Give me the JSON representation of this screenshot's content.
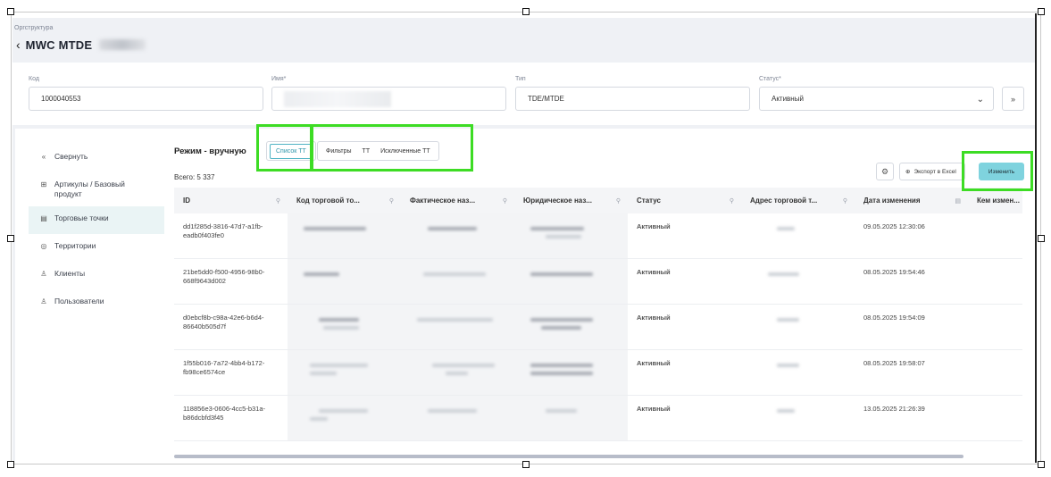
{
  "breadcrumb": "Оргструктура",
  "title": "MWC MTDE",
  "form": {
    "code_label": "Код",
    "code_value": "1000040553",
    "name_label": "Имя*",
    "type_label": "Тип",
    "type_value": "TDE/MTDE",
    "status_label": "Статус*",
    "status_value": "Активный"
  },
  "sidebar": {
    "items": [
      {
        "label": "Свернуть",
        "icon": "collapse-icon"
      },
      {
        "label": "Артикулы / Базовый продукт",
        "icon": "box-icon"
      },
      {
        "label": "Торговые точки",
        "icon": "store-icon"
      },
      {
        "label": "Территории",
        "icon": "map-pin-icon"
      },
      {
        "label": "Клиенты",
        "icon": "user-icon"
      },
      {
        "label": "Пользователи",
        "icon": "user-icon"
      }
    ]
  },
  "toolbar": {
    "mode": "Режим - вручную",
    "tabs_a": [
      "Список ТТ"
    ],
    "tabs_b": [
      "Фильтры",
      "ТТ",
      "Исключенные ТТ"
    ],
    "total": "Всего: 5 337",
    "export": "Экспорт в Excel",
    "edit": "Изменить"
  },
  "table": {
    "columns": [
      "ID",
      "Код торговой то...",
      "Фактическое наз...",
      "Юридическое наз...",
      "Статус",
      "Адрес торговой т...",
      "Дата изменения",
      "Кем измен..."
    ],
    "rows": [
      {
        "id": "dd1f285d-3816-47d7-a1fb-eadb0f403fe0",
        "status": "Активный",
        "date": "09.05.2025 12:30:06"
      },
      {
        "id": "21be5dd0-f500-4956-98b0-668f9643d002",
        "status": "Активный",
        "date": "08.05.2025 19:54:46"
      },
      {
        "id": "d0ebcf8b-c98a-42e6-b6d4-86640b505d7f",
        "status": "Активный",
        "date": "08.05.2025 19:54:09"
      },
      {
        "id": "1f55b016-7a72-4bb4-b172-fb98ce6574ce",
        "status": "Активный",
        "date": "08.05.2025 19:58:07"
      },
      {
        "id": "118856e3-0606-4cc5-b31a-b86dcbfd3f45",
        "status": "Активный",
        "date": "13.05.2025 21:26:39"
      }
    ]
  }
}
